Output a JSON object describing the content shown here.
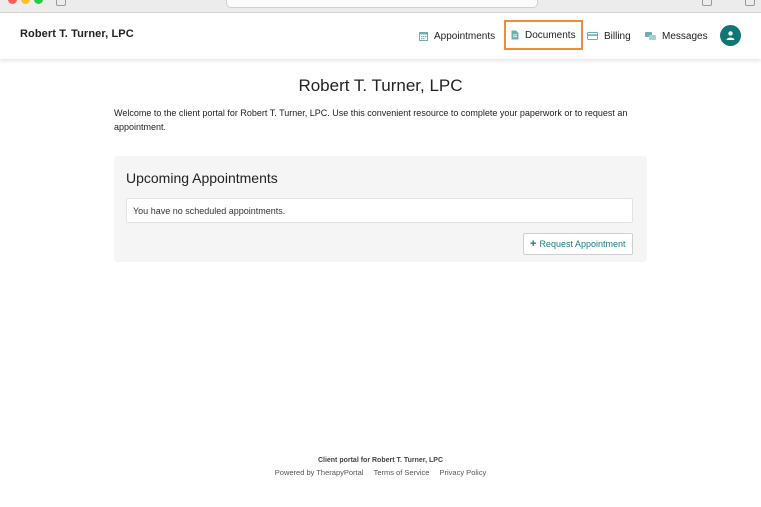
{
  "header": {
    "brand": "Robert T. Turner, LPC",
    "nav": {
      "appointments": "Appointments",
      "documents": "Documents",
      "billing": "Billing",
      "messages": "Messages"
    }
  },
  "main": {
    "title": "Robert T. Turner, LPC",
    "intro": "Welcome to the client portal for Robert T. Turner, LPC. Use this convenient resource to complete your paperwork or to request an appointment.",
    "upcoming": {
      "heading": "Upcoming Appointments",
      "empty_message": "You have no scheduled appointments.",
      "request_button": "Request Appointment"
    }
  },
  "footer": {
    "line1": "Client portal for Robert T. Turner, LPC",
    "powered_by": "Powered by TherapyPortal",
    "terms": "Terms of Service",
    "privacy": "Privacy Policy"
  },
  "colors": {
    "accent": "#0f7674",
    "highlight": "#f08a3c",
    "icon_teal": "#6bb0ae"
  },
  "icons": {
    "appointments": "calendar-icon",
    "documents": "document-icon",
    "billing": "credit-card-icon",
    "messages": "chat-icon",
    "avatar": "user-icon"
  }
}
